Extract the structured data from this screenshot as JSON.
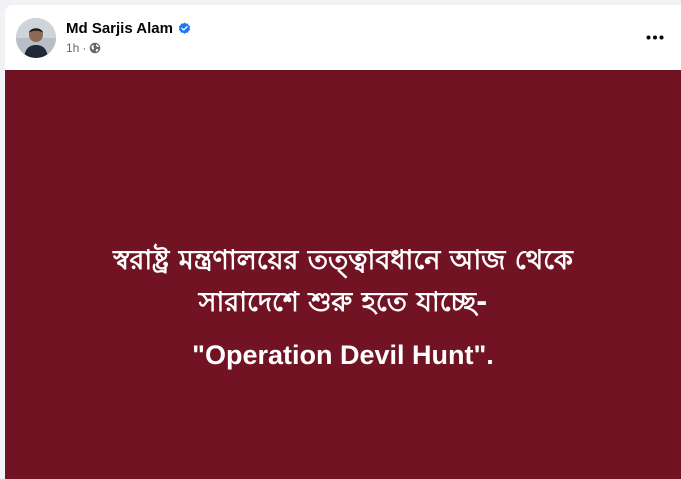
{
  "author": {
    "name": "Md Sarjis Alam",
    "verified": true
  },
  "meta": {
    "time": "1h",
    "separator": "·",
    "audience_icon": "globe-icon"
  },
  "menu": {
    "icon": "more-horizontal-icon"
  },
  "post_image": {
    "background_color": "#721323",
    "text_color": "#ffffff",
    "line1": "স্বরাষ্ট্র মন্ত্রণালয়ের তত্ত্বাবধানে আজ থেকে",
    "line2": "সারাদেশে শুরু হতে যাচ্ছে-",
    "line3": "\"Operation Devil Hunt\"."
  },
  "colors": {
    "verified_badge": "#1877f2",
    "secondary_text": "#65676b",
    "primary_text": "#050505"
  }
}
